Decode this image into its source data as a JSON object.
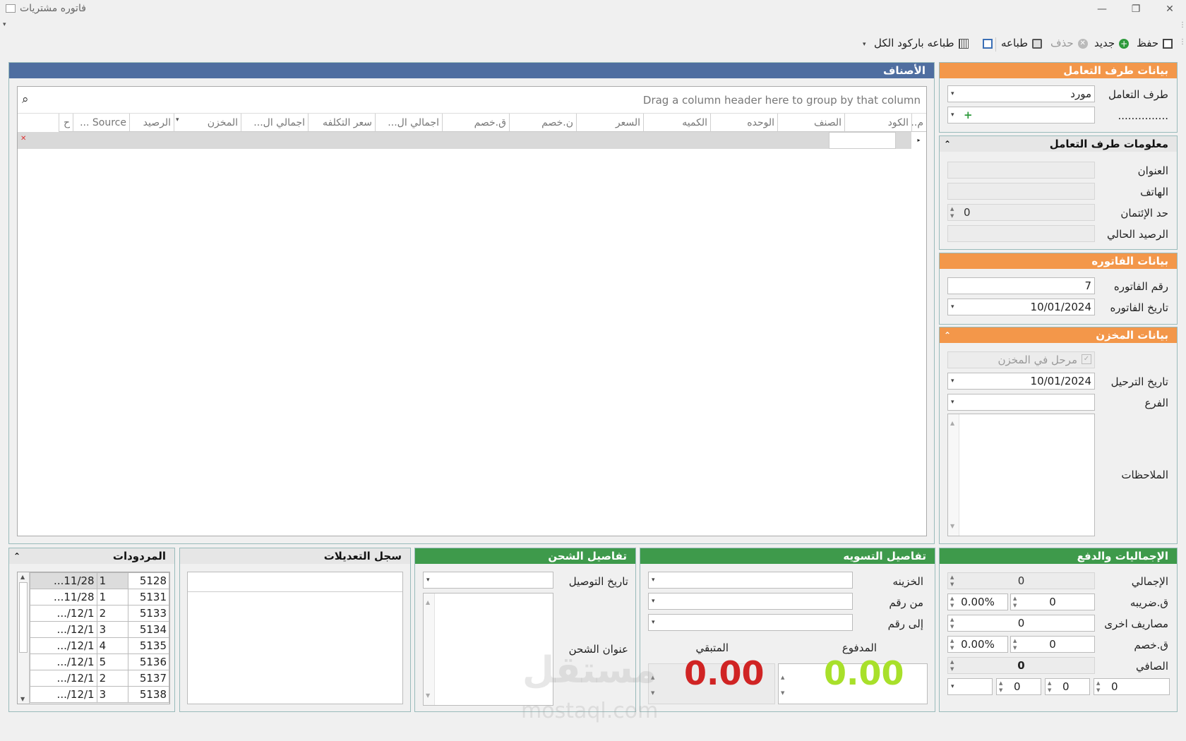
{
  "window": {
    "title": "فاتوره مشتريات"
  },
  "toolbar": {
    "save": "حفظ",
    "new": "جديد",
    "delete": "حذف",
    "print": "طباعه",
    "print_barcode": "طباعه باركود الكل"
  },
  "party": {
    "header": "بيانات طرف التعامل",
    "party_label": "طرف التعامل",
    "party_value": "مورد",
    "dots_label": "...............",
    "dots_value": "+"
  },
  "party_info": {
    "header": "معلومات طرف التعامل",
    "address_label": "العنوان",
    "phone_label": "الهاتف",
    "credit_label": "حد الإئتمان",
    "credit_value": "0",
    "balance_label": "الرصيد الحالي"
  },
  "invoice": {
    "header": "بيانات الفاتوره",
    "number_label": "رقم الفاتوره",
    "number_value": "7",
    "date_label": "تاريخ الفاتوره",
    "date_value": "10/01/2024"
  },
  "store": {
    "header": "بيانات المخزن",
    "posted_label": "مرحل في المخزن",
    "post_date_label": "تاريخ الترحيل",
    "post_date_value": "10/01/2024",
    "branch_label": "الفرع",
    "notes_label": "الملاحظات"
  },
  "items": {
    "header": "الأصناف",
    "group_hint": "Drag a column header here to group by that column",
    "columns": [
      "م..",
      "الكود",
      "الصنف",
      "الوحده",
      "الكميه",
      "السعر",
      "ن.خصم",
      "ق.خصم",
      "اجمالي ال...",
      "سعر التكلفه",
      "اجمالي ال...",
      "المخزن",
      "الرصيد",
      "Source ...",
      "ح"
    ]
  },
  "totals": {
    "header": "الإجماليات والدفع",
    "total_label": "الإجمالي",
    "total_value": "0",
    "tax_label": "ق.ضريبه",
    "tax_value": "0",
    "tax_pct": "0.00%",
    "other_label": "مصاريف اخرى",
    "other_value": "0",
    "discount_label": "ق.خصم",
    "discount_value": "0",
    "discount_pct": "0.00%",
    "net_label": "الصافي",
    "net_value": "0",
    "bottom_values": [
      "0",
      "0",
      "0"
    ]
  },
  "settlement": {
    "header": "تفاصيل التسويه",
    "treasury_label": "الخزينه",
    "from_label": "من رقم",
    "to_label": "إلى رقم",
    "paid_label": "المدفوع",
    "remaining_label": "المتبقي",
    "paid_value": "0.00",
    "remaining_value": "0.00",
    "paid_color": "#a8e02a",
    "remaining_color": "#d02424"
  },
  "shipping": {
    "header": "تفاصيل الشحن",
    "delivery_date_label": "تاريخ التوصيل",
    "address_label": "عنوان الشحن"
  },
  "log": {
    "header": "سجل التعديلات"
  },
  "returns": {
    "header": "المردودات",
    "rows": [
      {
        "id": "5128",
        "qty": "1",
        "date": "11/28..."
      },
      {
        "id": "5131",
        "qty": "1",
        "date": "11/28..."
      },
      {
        "id": "5133",
        "qty": "2",
        "date": "12/1/..."
      },
      {
        "id": "5134",
        "qty": "3",
        "date": "12/1/..."
      },
      {
        "id": "5135",
        "qty": "4",
        "date": "12/1/..."
      },
      {
        "id": "5136",
        "qty": "5",
        "date": "12/1/..."
      },
      {
        "id": "5137",
        "qty": "2",
        "date": "12/1/..."
      },
      {
        "id": "5138",
        "qty": "3",
        "date": "12/1/..."
      }
    ]
  },
  "watermark": {
    "text": "مستقل",
    "sub": "mostaql.com"
  }
}
